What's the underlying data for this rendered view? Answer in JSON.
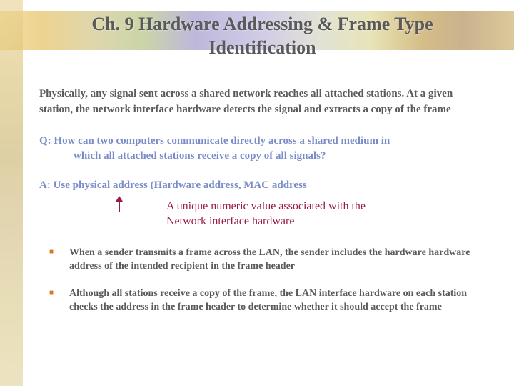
{
  "title": "Ch. 9 Hardware Addressing & Frame Type Identification",
  "intro": "Physically, any signal sent across a shared network reaches all attached stations. At a given station, the network interface hardware detects the signal and extracts a copy of the frame",
  "question_line1": "Q: How can two computers communicate directly across a shared medium in",
  "question_line2": "which all attached stations receive a copy of all signals?",
  "answer_prefix": "A: Use ",
  "answer_underlined": "physical address (",
  "answer_suffix": "Hardware address, MAC address",
  "annotation_line1": "A unique numeric value associated with the",
  "annotation_line2": "Network interface hardware",
  "bullets": [
    "When a sender transmits a frame across the LAN, the sender includes the hardware hardware address of the intended recipient in the frame header",
    "Although all stations receive a copy of the frame, the LAN interface hardware on each station checks the address in the frame header to determine whether it should accept the frame"
  ]
}
